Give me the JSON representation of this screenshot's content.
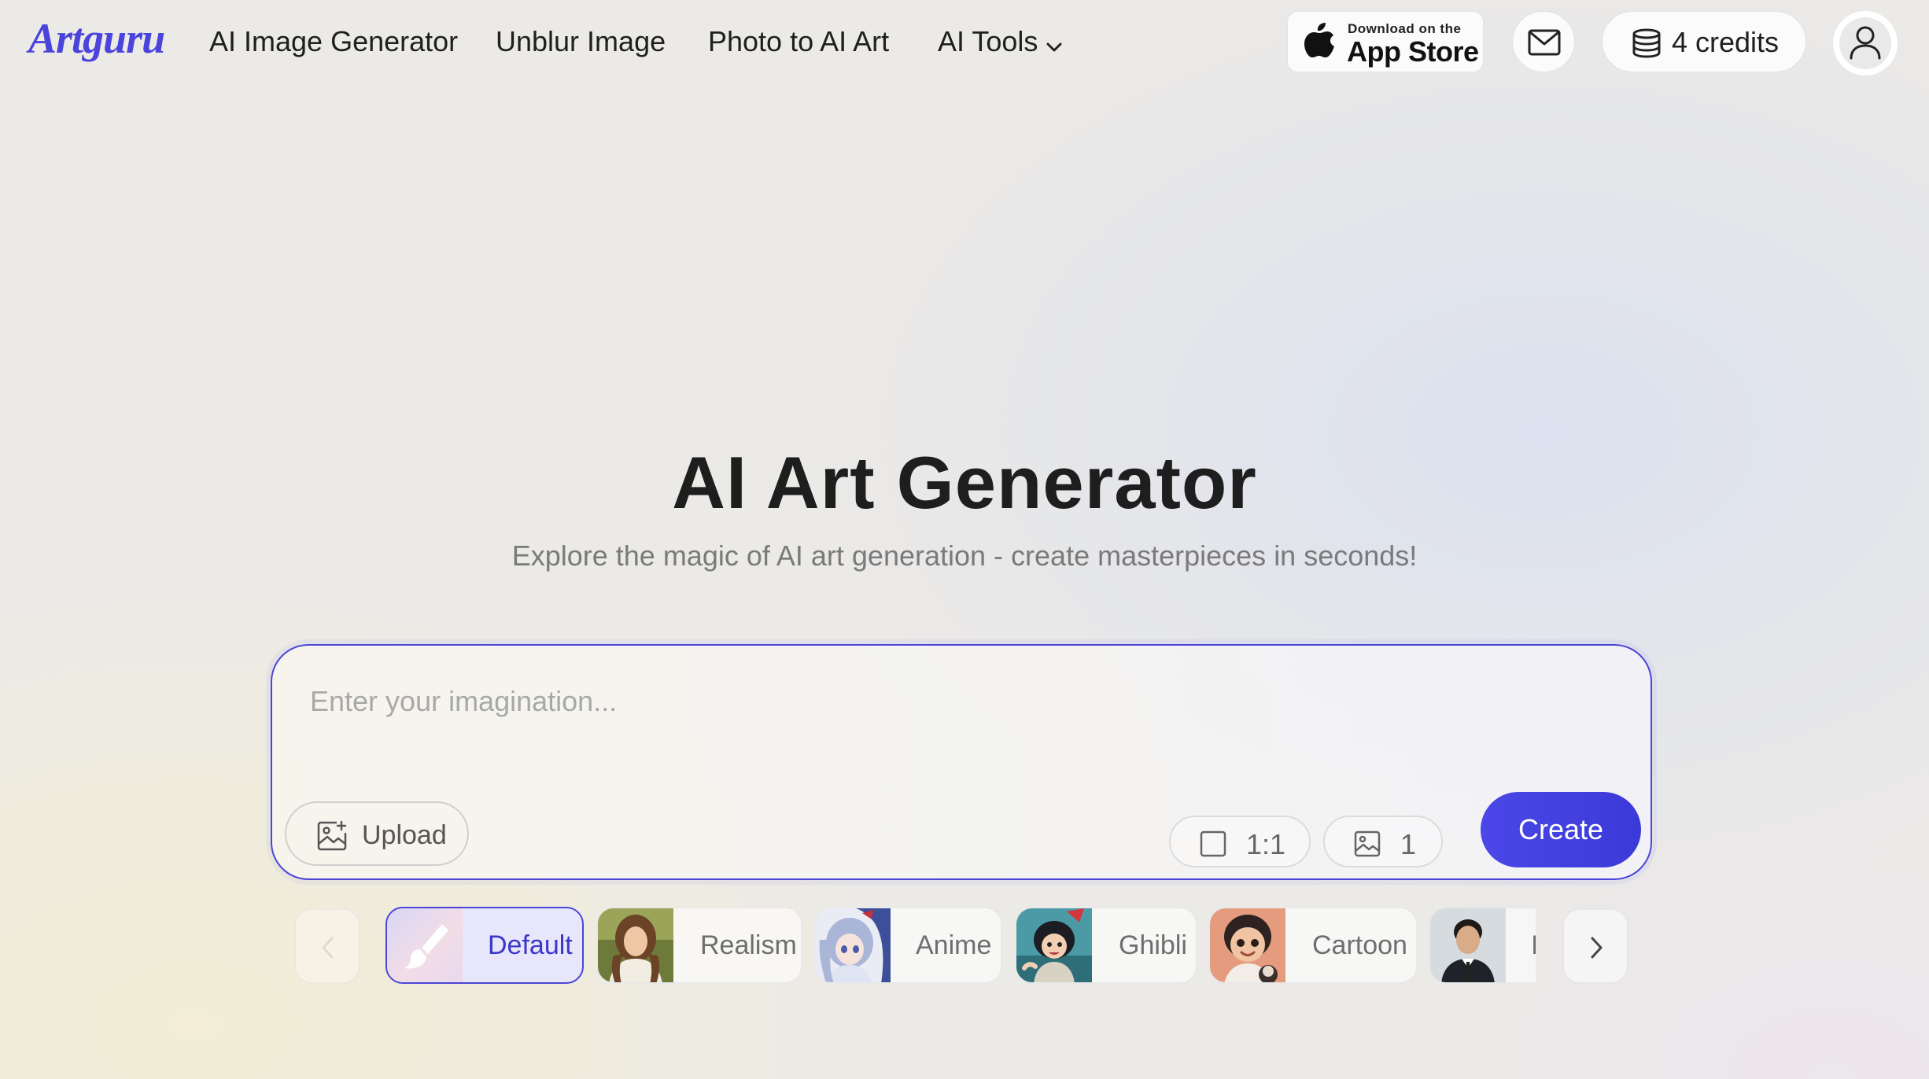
{
  "brand": {
    "logo": "Artguru",
    "accent_color": "#4b46d8"
  },
  "nav": {
    "links": [
      {
        "label": "AI Image Generator"
      },
      {
        "label": "Unblur Image"
      },
      {
        "label": "Photo to AI Art"
      },
      {
        "label": "AI Tools"
      }
    ]
  },
  "header": {
    "app_store": {
      "small": "Download on the",
      "big": "App Store",
      "icon": "apple-icon"
    },
    "mail_icon": "mail-icon",
    "credits": {
      "label": "4 credits",
      "icon": "coins-stack-icon"
    },
    "account_icon": "user-icon"
  },
  "hero": {
    "title": "AI Art Generator",
    "subtitle": "Explore the magic of AI art generation - create masterpieces in seconds!"
  },
  "prompt": {
    "placeholder": "Enter your imagination...",
    "value": "",
    "upload_label": "Upload",
    "aspect_ratio": "1:1",
    "image_count": "1",
    "create_label": "Create"
  },
  "styles": {
    "items": [
      {
        "label": "Default",
        "selected": true
      },
      {
        "label": "Realism",
        "selected": false
      },
      {
        "label": "Anime",
        "selected": false
      },
      {
        "label": "Ghibli",
        "selected": false
      },
      {
        "label": "Cartoon",
        "selected": false
      },
      {
        "label": "I",
        "selected": false
      }
    ]
  }
}
